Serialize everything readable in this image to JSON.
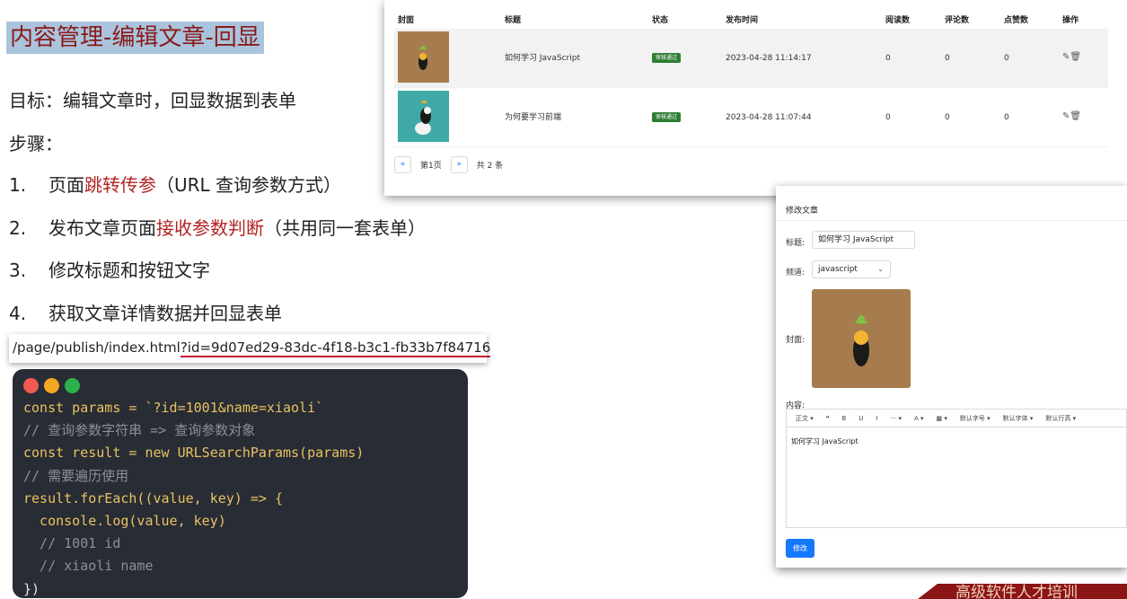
{
  "slide": {
    "title": "内容管理-编辑文章-回显",
    "goal": "目标：编辑文章时，回显数据到表单",
    "steps_label": "步骤：",
    "steps": [
      {
        "num": "1.",
        "pre": "页面",
        "hl": "跳转传参",
        "post": "（URL 查询参数方式）"
      },
      {
        "num": "2.",
        "pre": "发布文章页面",
        "hl": "接收参数判断",
        "post": "（共用同一套表单）"
      },
      {
        "num": "3.",
        "pre": "修改标题和按钮文字",
        "hl": "",
        "post": ""
      },
      {
        "num": "4.",
        "pre": "获取文章详情数据并回显表单",
        "hl": "",
        "post": ""
      }
    ],
    "url_path": "/page/publish/index.html",
    "url_query": "?id=9d07ed29-83dc-4f18-b3c1-fb33b7f84716",
    "footer": "高级软件人才培训"
  },
  "code_window": {
    "dot_colors": [
      "#f05a4f",
      "#f5a623",
      "#2bb24c"
    ],
    "lines": [
      [
        "const params = `?id=1001&name=xiaoli`"
      ],
      [
        "// 查询参数字符串 => 查询参数对象"
      ],
      [
        "const result = new URLSearchParams(params)"
      ],
      [
        "// 需要遍历使用"
      ],
      [
        "result.forEach((value, key) => {"
      ],
      [
        "  console.log(value, key)"
      ],
      [
        "  // 1001 id"
      ],
      [
        "  // xiaoli name"
      ],
      [
        "})"
      ]
    ]
  },
  "article_table": {
    "headers": [
      "封面",
      "标题",
      "状态",
      "发布时间",
      "阅读数",
      "评论数",
      "点赞数",
      "操作"
    ],
    "rows": [
      {
        "title": "如何学习 JavaScript",
        "status": "审核通过",
        "time": "2023-04-28 11:14:17",
        "reads": "0",
        "comments": "0",
        "likes": "0"
      },
      {
        "title": "为何要学习前端",
        "status": "审核通过",
        "time": "2023-04-28 11:07:44",
        "reads": "0",
        "comments": "0",
        "likes": "0"
      }
    ],
    "pager": {
      "prev": "«",
      "page": "第1页",
      "next": "»",
      "total": "共 2 条"
    },
    "icons": {
      "edit": "edit-icon",
      "delete": "trash-icon"
    }
  },
  "edit_form": {
    "title": "修改文章",
    "title_label": "标题:",
    "title_value": "如何学习 JavaScript",
    "channel_label": "频道:",
    "channel_value": "javascript",
    "cover_label": "封面:",
    "content_label": "内容:",
    "toolbar": [
      "正文 ▾",
      "❝",
      "B",
      "U",
      "I",
      "··· ▾",
      "A ▾",
      "▩ ▾",
      "默认字号 ▾",
      "默认字体 ▾",
      "默认行高 ▾"
    ],
    "content_text": "如何学习 JavaScript",
    "submit_label": "修改"
  }
}
